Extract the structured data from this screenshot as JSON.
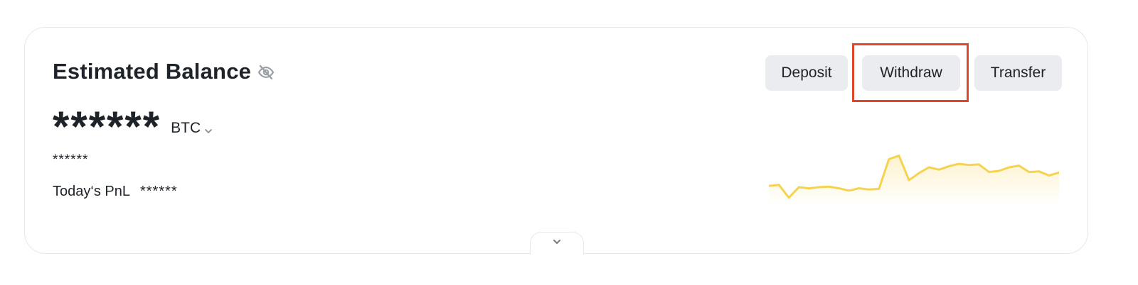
{
  "balance_card": {
    "title": "Estimated Balance",
    "hide_icon": "eye-slash-icon",
    "balance_value": "******",
    "currency": "BTC",
    "currency_icon": "chevron-down-icon",
    "fiat_value": "******",
    "pnl_label": "Today‘s PnL",
    "pnl_value": "******"
  },
  "actions": {
    "deposit_label": "Deposit",
    "withdraw_label": "Withdraw",
    "transfer_label": "Transfer",
    "highlighted": "Withdraw",
    "highlight_color": "#e0462a"
  },
  "sparkline": {
    "color": "#f5d34f",
    "values": [
      40,
      41,
      30,
      39,
      38,
      39,
      39.5,
      38,
      36,
      38,
      37,
      37.5,
      63,
      66,
      45,
      51,
      56,
      54,
      57,
      59,
      58,
      58.5,
      52,
      53,
      56,
      57.5,
      52,
      52.5,
      49,
      51.5
    ]
  },
  "expand": {
    "icon": "chevron-down-icon"
  },
  "colors": {
    "text": "#1e2329",
    "button_bg": "#eaecef",
    "border": "#e6e8ea"
  }
}
